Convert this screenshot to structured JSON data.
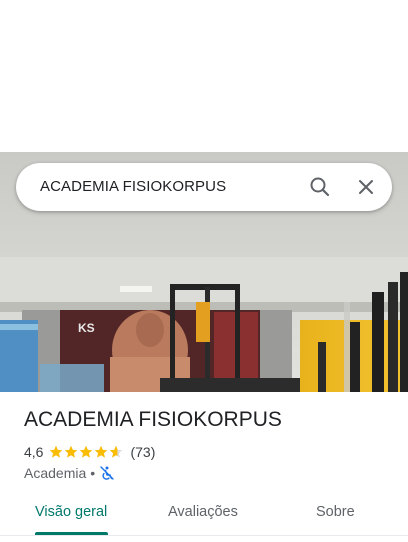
{
  "search": {
    "query": "ACADEMIA FISIOKORPUS",
    "search_icon": "search-icon",
    "close_icon": "close-icon"
  },
  "place": {
    "name": "ACADEMIA FISIOKORPUS",
    "rating": "4,6",
    "stars": 4.6,
    "reviews": "(73)",
    "category": "Academia",
    "separator": "•",
    "accessibility_icon": "not-accessible-icon"
  },
  "tabs": [
    {
      "label": "Visão geral",
      "active": true
    },
    {
      "label": "Avaliações",
      "active": false
    },
    {
      "label": "Sobre",
      "active": false
    }
  ],
  "colors": {
    "accent": "#00796b",
    "star": "#fbbc04",
    "accessibility_icon": "#1a73e8"
  }
}
